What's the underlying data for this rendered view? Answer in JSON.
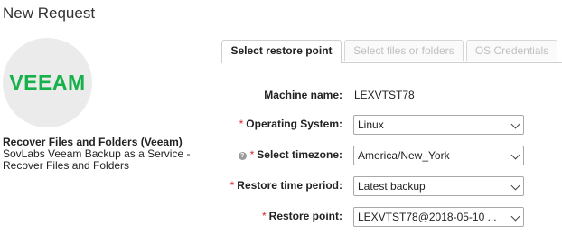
{
  "page": {
    "title": "New Request"
  },
  "logo": {
    "text": "VEEAM",
    "color": "#17b14b"
  },
  "catalog_item": {
    "title": "Recover Files and Folders (Veeam)",
    "description": "SovLabs Veeam Backup as a Service - Recover Files and Folders"
  },
  "tabs": [
    {
      "label": "Select restore point",
      "active": true
    },
    {
      "label": "Select files or folders",
      "active": false
    },
    {
      "label": "OS Credentials",
      "active": false
    }
  ],
  "form": {
    "machine_name": {
      "label": "Machine name:",
      "value": "LEXVTST78"
    },
    "operating_system": {
      "label": "Operating System:",
      "value": "Linux",
      "required": true
    },
    "timezone": {
      "label": "Select timezone:",
      "value": "America/New_York",
      "required": true,
      "help_icon": "help-icon"
    },
    "restore_time_period": {
      "label": "Restore time period:",
      "value": "Latest backup",
      "required": true
    },
    "restore_point": {
      "label": "Restore point:",
      "value": "LEXVTST78@2018-05-10 ...",
      "required": true
    }
  },
  "required_marker": "*",
  "colors": {
    "required": "#d42a2a",
    "accent": "#17b14b"
  }
}
